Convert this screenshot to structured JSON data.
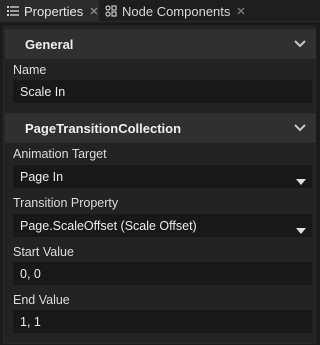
{
  "tabs": [
    {
      "label": "Properties",
      "icon": "list-icon",
      "close": "close-icon"
    },
    {
      "label": "Node Components",
      "icon": "components-icon",
      "close": "close-icon"
    }
  ],
  "sections": {
    "general": {
      "title": "General"
    },
    "transition": {
      "title": "PageTransitionCollection"
    }
  },
  "fields": {
    "name": {
      "label": "Name",
      "value": "Scale In"
    },
    "animation_target": {
      "label": "Animation Target",
      "value": "Page In"
    },
    "transition_property": {
      "label": "Transition Property",
      "value": "Page.ScaleOffset (Scale Offset)"
    },
    "start_value": {
      "label": "Start Value",
      "value": "0, 0"
    },
    "end_value": {
      "label": "End Value",
      "value": "1, 1"
    }
  },
  "colors": {
    "background": "#1b1b1b",
    "panel": "#232323",
    "section_header": "#303030",
    "field": "#181818"
  }
}
